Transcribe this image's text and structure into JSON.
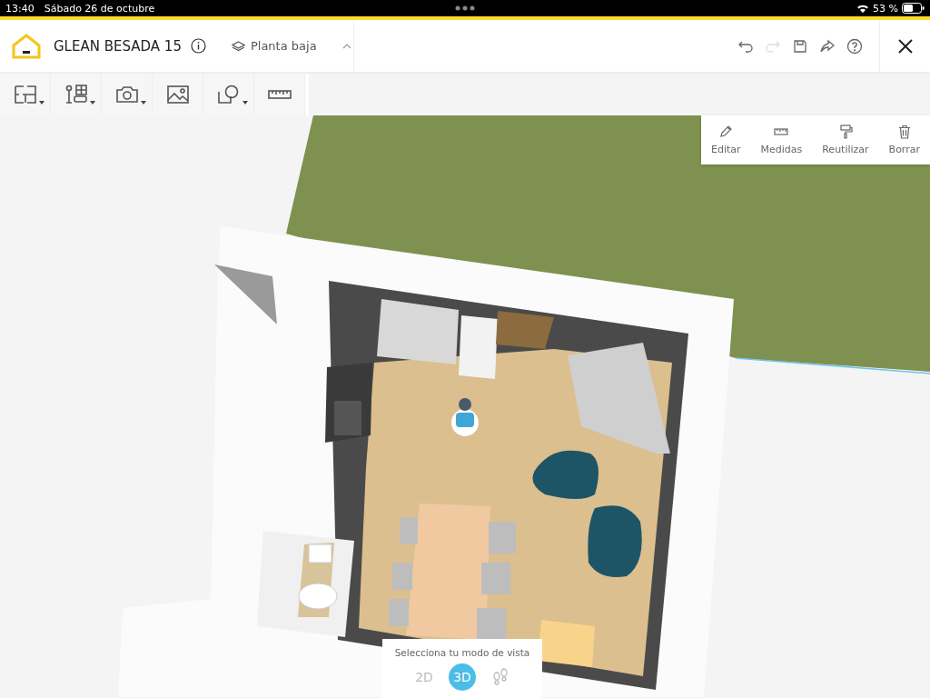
{
  "status_bar": {
    "time": "13:40",
    "date": "Sábado 26 de octubre",
    "battery": "53 %"
  },
  "header": {
    "title": "GLEAN BESADA 15",
    "floor": "Planta baja"
  },
  "header_actions": [
    {
      "kind": "undo",
      "disabled": false
    },
    {
      "kind": "redo",
      "disabled": true
    },
    {
      "kind": "save",
      "disabled": false
    },
    {
      "kind": "share",
      "disabled": false
    },
    {
      "kind": "help",
      "disabled": false
    }
  ],
  "toolbar": [
    {
      "kind": "walls",
      "dropdown": true
    },
    {
      "kind": "furniture",
      "dropdown": true
    },
    {
      "kind": "camera",
      "dropdown": true
    },
    {
      "kind": "image",
      "dropdown": false
    },
    {
      "kind": "shapes",
      "dropdown": true
    },
    {
      "kind": "ruler",
      "dropdown": false
    }
  ],
  "context_menu": [
    {
      "kind": "edit",
      "label": "Editar"
    },
    {
      "kind": "measure",
      "label": "Medidas"
    },
    {
      "kind": "reuse",
      "label": "Reutilizar"
    },
    {
      "kind": "delete",
      "label": "Borrar"
    }
  ],
  "view_mode": {
    "label": "Selecciona tu modo de vista",
    "modes": [
      {
        "kind": "text",
        "label": "2D",
        "selected": false
      },
      {
        "kind": "text",
        "label": "3D",
        "selected": true
      },
      {
        "kind": "walk",
        "selected": false
      }
    ]
  }
}
